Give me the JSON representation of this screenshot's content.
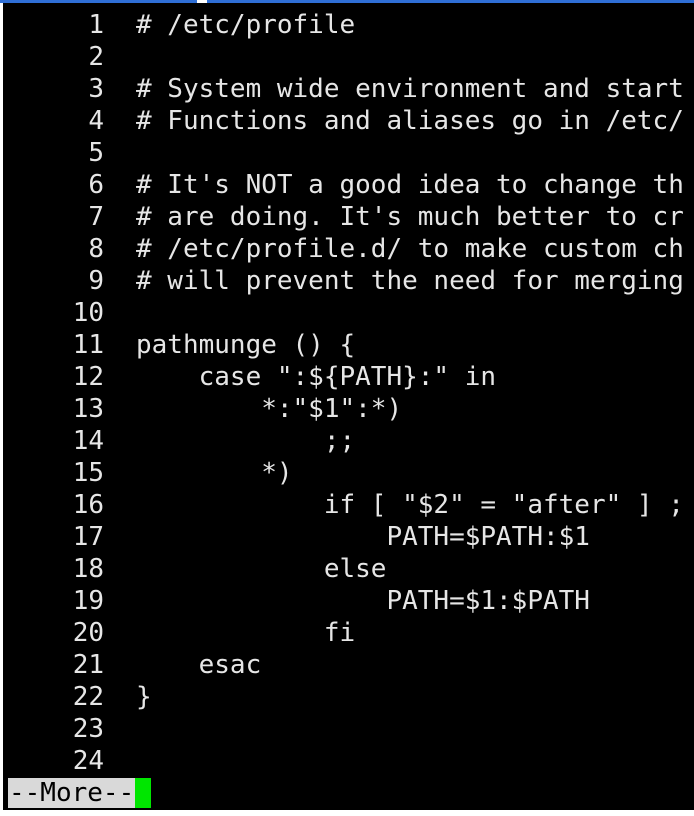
{
  "terminal": {
    "lines": [
      {
        "num": "1",
        "text": "# /etc/profile"
      },
      {
        "num": "2",
        "text": ""
      },
      {
        "num": "3",
        "text": "# System wide environment and start"
      },
      {
        "num": "4",
        "text": "# Functions and aliases go in /etc/"
      },
      {
        "num": "5",
        "text": ""
      },
      {
        "num": "6",
        "text": "# It's NOT a good idea to change th"
      },
      {
        "num": "7",
        "text": "# are doing. It's much better to cr"
      },
      {
        "num": "8",
        "text": "# /etc/profile.d/ to make custom ch"
      },
      {
        "num": "9",
        "text": "# will prevent the need for merging"
      },
      {
        "num": "10",
        "text": ""
      },
      {
        "num": "11",
        "text": "pathmunge () {"
      },
      {
        "num": "12",
        "text": "    case \":${PATH}:\" in"
      },
      {
        "num": "13",
        "text": "        *:\"$1\":*)"
      },
      {
        "num": "14",
        "text": "            ;;"
      },
      {
        "num": "15",
        "text": "        *)"
      },
      {
        "num": "16",
        "text": "            if [ \"$2\" = \"after\" ] ;"
      },
      {
        "num": "17",
        "text": "                PATH=$PATH:$1"
      },
      {
        "num": "18",
        "text": "            else"
      },
      {
        "num": "19",
        "text": "                PATH=$1:$PATH"
      },
      {
        "num": "20",
        "text": "            fi"
      },
      {
        "num": "21",
        "text": "    esac"
      },
      {
        "num": "22",
        "text": "}"
      },
      {
        "num": "23",
        "text": ""
      },
      {
        "num": "24",
        "text": ""
      }
    ],
    "pager_prompt": "--More--",
    "colors": {
      "background": "#000000",
      "foreground": "#e6e6e6",
      "prompt_background": "#d9d9d9",
      "cursor": "#00e600"
    }
  }
}
